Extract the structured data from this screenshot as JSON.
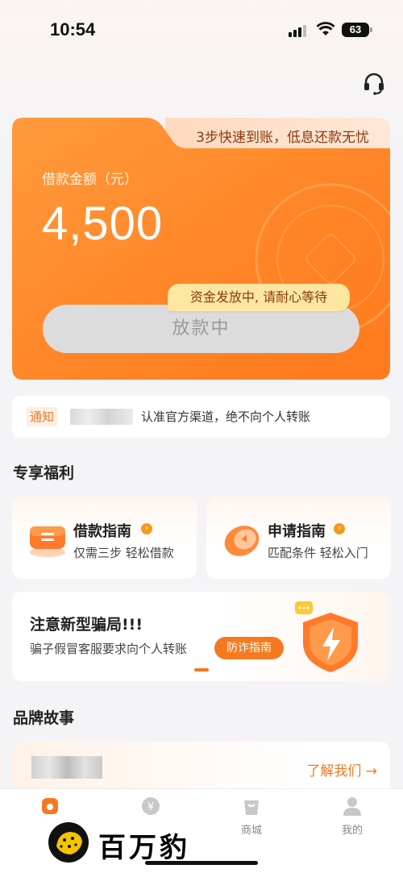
{
  "status_bar": {
    "time": "10:54",
    "battery": "63"
  },
  "loan_card": {
    "tagline": "3步快速到账，低息还款无忧",
    "amount_label": "借款金额（元）",
    "amount": "4,500",
    "progress_tip": "资金发放中, 请耐心等待",
    "status_button": "放款中"
  },
  "notice": {
    "tag": "通知",
    "text": "认准官方渠道，绝不向个人转账"
  },
  "benefits": {
    "title": "专享福利",
    "cards": [
      {
        "title": "借款指南",
        "subtitle": "仅需三步 轻松借款",
        "icon": "ticket-icon"
      },
      {
        "title": "申请指南",
        "subtitle": "匹配条件 轻松入门",
        "icon": "coin-icon"
      }
    ]
  },
  "fraud": {
    "title": "注意新型骗局!!!",
    "subtitle": "骗子假冒客服要求向个人转账",
    "button": "防诈指南",
    "icon": "shield-icon"
  },
  "brand": {
    "title": "品牌故事",
    "link": "了解我们 →"
  },
  "tabbar": {
    "items": [
      {
        "label": "",
        "icon": "home-icon"
      },
      {
        "label": "",
        "icon": "yen-icon"
      },
      {
        "label": "商城",
        "icon": "shop-bag-icon"
      },
      {
        "label": "我的",
        "icon": "user-icon"
      }
    ]
  },
  "watermark": {
    "text": "百万豹"
  },
  "colors": {
    "accent": "#f47a22",
    "card_orange": "#ff8a2a",
    "tip_yellow": "#fde7a0"
  }
}
